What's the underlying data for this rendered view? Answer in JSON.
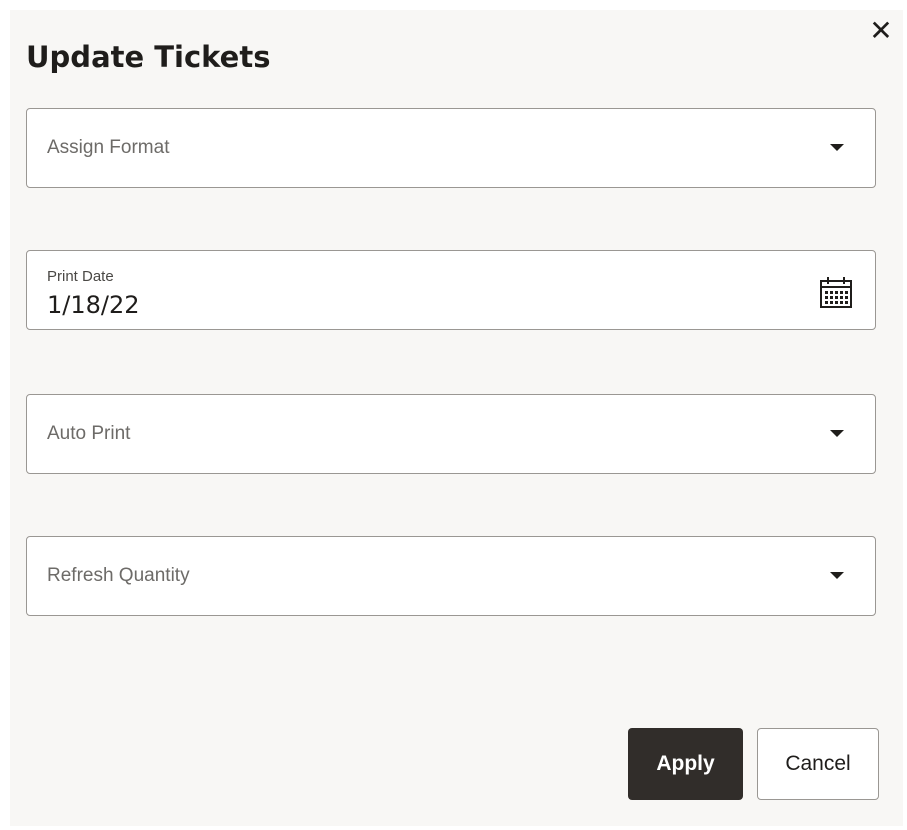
{
  "dialog": {
    "title": "Update Tickets",
    "close_glyph": "✕"
  },
  "fields": {
    "assign_format": {
      "placeholder": "Assign Format",
      "icon": "chevron-down-icon"
    },
    "print_date": {
      "label": "Print Date",
      "value": "1/18/22",
      "icon": "calendar-icon"
    },
    "auto_print": {
      "placeholder": "Auto Print",
      "icon": "chevron-down-icon"
    },
    "refresh_quantity": {
      "placeholder": "Refresh Quantity",
      "icon": "chevron-down-icon"
    }
  },
  "actions": {
    "apply_label": "Apply",
    "cancel_label": "Cancel"
  },
  "colors": {
    "background": "#f8f7f5",
    "primary_button": "#312d2a",
    "border": "#9a9793",
    "text": "#1f1d1b"
  }
}
